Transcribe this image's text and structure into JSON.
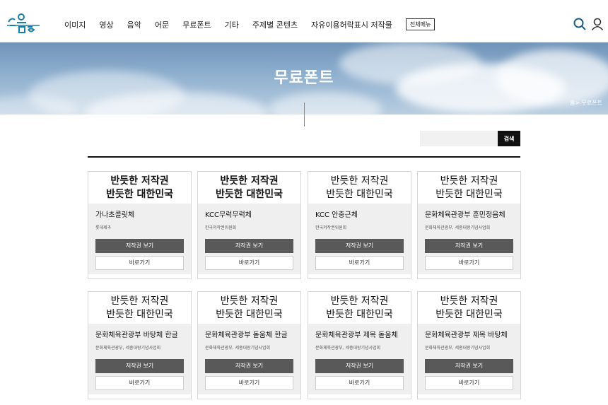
{
  "header": {
    "logo_text": "공유마당",
    "nav": [
      "이미지",
      "영상",
      "음악",
      "어문",
      "무료폰트",
      "기타",
      "주제별 콘텐츠",
      "자유이용허락표시 저작물"
    ],
    "all_menu": "전체메뉴",
    "icons": [
      "search-icon",
      "user-icon"
    ],
    "accent": "#1a7fa6"
  },
  "banner": {
    "title": "무료폰트",
    "breadcrumb": "홈> 무료폰트"
  },
  "search": {
    "placeholder": "",
    "button": "검색"
  },
  "cards": [
    {
      "preview": [
        "반듯한 저작권",
        "반듯한 대한민국"
      ],
      "name": "가나초콜릿체",
      "org": "롯데제과",
      "copyright_btn": "저작권 보기",
      "go_btn": "바로가기"
    },
    {
      "preview": [
        "반듯한 저작권",
        "반듯한 대한민국"
      ],
      "name": "KCC무럭무럭체",
      "org": "한국저작권위원회",
      "copyright_btn": "저작권 보기",
      "go_btn": "바로가기"
    },
    {
      "preview": [
        "반듯한 저작권",
        "반듯한 대한민국"
      ],
      "name": "KCC 안중근체",
      "org": "한국저작권위원회",
      "copyright_btn": "저작권 보기",
      "go_btn": "바로가기"
    },
    {
      "preview": [
        "반듯한 저작권",
        "반듯한 대한민국"
      ],
      "name": "문화체육관광부 훈민정음체",
      "org": "문화체육관광부, 세종대왕기념사업회",
      "copyright_btn": "저작권 보기",
      "go_btn": "바로가기"
    },
    {
      "preview": [
        "반듯한 저작권",
        "반듯한 대한민국"
      ],
      "name": "문화체육관광부 바탕체 한글",
      "org": "문화체육관광부, 세종대왕기념사업회",
      "copyright_btn": "저작권 보기",
      "go_btn": "바로가기"
    },
    {
      "preview": [
        "반듯한 저작권",
        "반듯한 대한민국"
      ],
      "name": "문화체육관광부 돋움체 한글",
      "org": "문화체육관광부, 세종대왕기념사업회",
      "copyright_btn": "저작권 보기",
      "go_btn": "바로가기"
    },
    {
      "preview": [
        "반듯한 저작권",
        "반듯한 대한민국"
      ],
      "name": "문화체육관광부 제목 돋움체",
      "org": "문화체육관광부, 세종대왕기념사업회",
      "copyright_btn": "저작권 보기",
      "go_btn": "바로가기"
    },
    {
      "preview": [
        "반듯한 저작권",
        "반듯한 대한민국"
      ],
      "name": "문화체육관광부 제목 바탕체",
      "org": "문화체육관광부, 세종대왕기념사업회",
      "copyright_btn": "저작권 보기",
      "go_btn": "바로가기"
    }
  ]
}
